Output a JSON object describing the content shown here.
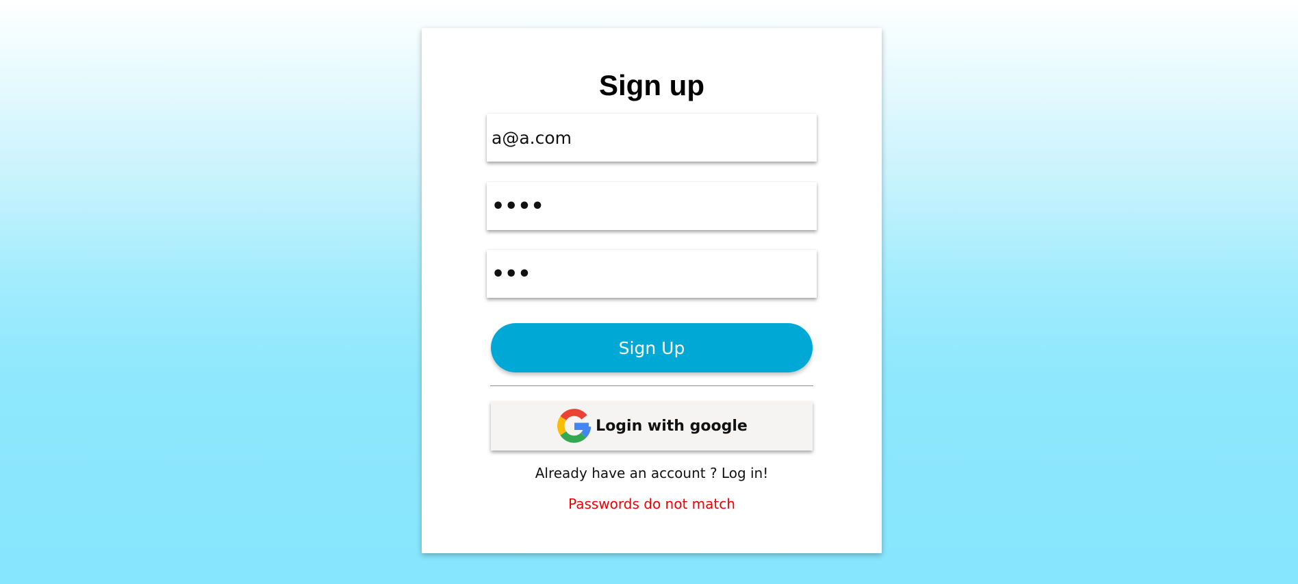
{
  "form": {
    "title": "Sign up",
    "email_value": "a@a.com",
    "password_value": "••••",
    "confirm_password_value": "•••",
    "signup_label": "Sign Up",
    "google_label": "Login with google",
    "login_prefix": "Already have an account ?",
    "login_link": "Log in!",
    "error_message": "Passwords do not match"
  },
  "colors": {
    "primary_button": "#00a9d5",
    "error_text": "#ee0000",
    "google_button_bg": "#f5f4f2"
  },
  "icons": {
    "google": "google-icon"
  }
}
